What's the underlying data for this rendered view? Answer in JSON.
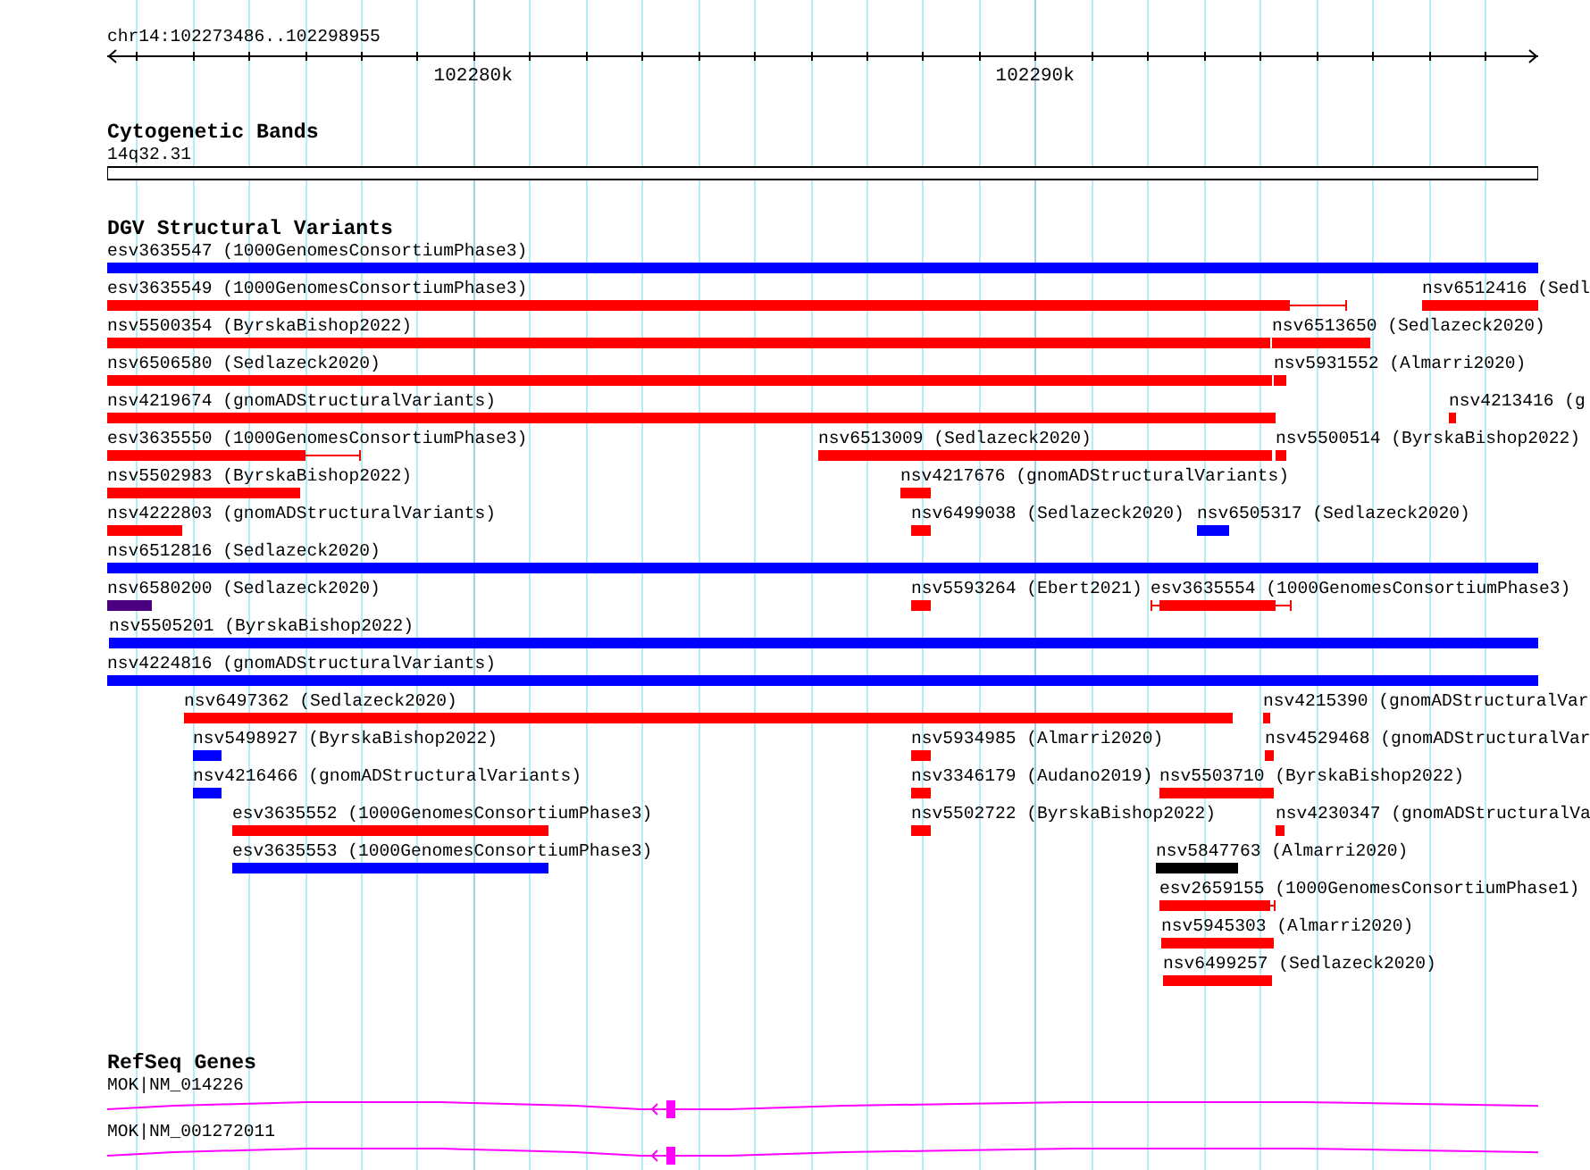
{
  "ruler": {
    "location": "chr14:102273486..102298955",
    "major_ticks": [
      {
        "label": "102280k"
      },
      {
        "label": "102290k"
      }
    ]
  },
  "tracks": [
    {
      "kind": "bands",
      "title": "Cytogenetic Bands",
      "bands": [
        {
          "label": "14q32.31"
        }
      ]
    },
    {
      "kind": "variants",
      "title": "DGV Structural Variants",
      "rows": [
        {
          "features": [
            {
              "label": "esv3635547 (1000GenomesConsortiumPhase3)",
              "color": "#0000ff"
            }
          ]
        },
        {
          "features": [
            {
              "label": "esv3635549 (1000GenomesConsortiumPhase3)",
              "color": "#ff0000"
            },
            {
              "label": "nsv6512416 (Sedl",
              "color": "#ff0000"
            }
          ]
        },
        {
          "features": [
            {
              "label": "nsv5500354 (ByrskaBishop2022)",
              "color": "#ff0000"
            },
            {
              "label": "nsv6513650 (Sedlazeck2020)",
              "color": "#ff0000"
            }
          ]
        },
        {
          "features": [
            {
              "label": "nsv6506580 (Sedlazeck2020)",
              "color": "#ff0000"
            },
            {
              "label": "nsv5931552 (Almarri2020)",
              "color": "#ff0000"
            }
          ]
        },
        {
          "features": [
            {
              "label": "nsv4219674 (gnomADStructuralVariants)",
              "color": "#ff0000"
            },
            {
              "label": "nsv4213416 (g",
              "color": "#ff0000"
            }
          ]
        },
        {
          "features": [
            {
              "label": "esv3635550 (1000GenomesConsortiumPhase3)",
              "color": "#ff0000"
            },
            {
              "label": "nsv6513009 (Sedlazeck2020)",
              "color": "#ff0000"
            },
            {
              "label": "nsv5500514 (ByrskaBishop2022)",
              "color": "#ff0000"
            }
          ]
        },
        {
          "features": [
            {
              "label": "nsv5502983 (ByrskaBishop2022)",
              "color": "#ff0000"
            },
            {
              "label": "nsv4217676 (gnomADStructuralVariants)",
              "color": "#ff0000"
            }
          ]
        },
        {
          "features": [
            {
              "label": "nsv4222803 (gnomADStructuralVariants)",
              "color": "#ff0000"
            },
            {
              "label": "nsv6499038 (Sedlazeck2020)",
              "color": "#ff0000"
            },
            {
              "label": "nsv6505317 (Sedlazeck2020)",
              "color": "#0000ff"
            }
          ]
        },
        {
          "features": [
            {
              "label": "nsv6512816 (Sedlazeck2020)",
              "color": "#0000ff"
            }
          ]
        },
        {
          "features": [
            {
              "label": "nsv6580200 (Sedlazeck2020)",
              "color": "#4b0082"
            },
            {
              "label": "nsv5593264 (Ebert2021)",
              "color": "#ff0000"
            },
            {
              "label": "esv3635554 (1000GenomesConsortiumPhase3)",
              "color": "#ff0000"
            }
          ]
        },
        {
          "features": [
            {
              "label": "nsv5505201 (ByrskaBishop2022)",
              "color": "#0000ff"
            }
          ]
        },
        {
          "features": [
            {
              "label": "nsv4224816 (gnomADStructuralVariants)",
              "color": "#0000ff"
            }
          ]
        },
        {
          "features": [
            {
              "label": "nsv6497362 (Sedlazeck2020)",
              "color": "#ff0000"
            },
            {
              "label": "nsv4215390 (gnomADStructuralVar",
              "color": "#ff0000"
            }
          ]
        },
        {
          "features": [
            {
              "label": "nsv5498927 (ByrskaBishop2022)",
              "color": "#0000ff"
            },
            {
              "label": "nsv5934985 (Almarri2020)",
              "color": "#ff0000"
            },
            {
              "label": "nsv4529468 (gnomADStructuralVar",
              "color": "#ff0000"
            }
          ]
        },
        {
          "features": [
            {
              "label": "nsv4216466 (gnomADStructuralVariants)",
              "color": "#0000ff"
            },
            {
              "label": "nsv3346179 (Audano2019)",
              "color": "#ff0000"
            },
            {
              "label": "nsv5503710 (ByrskaBishop2022)",
              "color": "#ff0000"
            }
          ]
        },
        {
          "features": [
            {
              "label": "esv3635552 (1000GenomesConsortiumPhase3)",
              "color": "#ff0000"
            },
            {
              "label": "nsv5502722 (ByrskaBishop2022)",
              "color": "#ff0000"
            },
            {
              "label": "nsv4230347 (gnomADStructuralVa",
              "color": "#ff0000"
            }
          ]
        },
        {
          "features": [
            {
              "label": "esv3635553 (1000GenomesConsortiumPhase3)",
              "color": "#0000ff"
            },
            {
              "label": "nsv5847763 (Almarri2020)",
              "color": "#000000"
            }
          ]
        },
        {
          "features": [
            {
              "label": "esv2659155 (1000GenomesConsortiumPhase1)",
              "color": "#ff0000"
            }
          ]
        },
        {
          "features": [
            {
              "label": "nsv5945303 (Almarri2020)",
              "color": "#ff0000"
            }
          ]
        },
        {
          "features": [
            {
              "label": "nsv6499257 (Sedlazeck2020)",
              "color": "#ff0000"
            }
          ]
        }
      ]
    },
    {
      "kind": "genes",
      "title": "RefSeq Genes",
      "genes": [
        {
          "label": "MOK|NM_014226"
        },
        {
          "label": "MOK|NM_001272011"
        }
      ]
    }
  ]
}
